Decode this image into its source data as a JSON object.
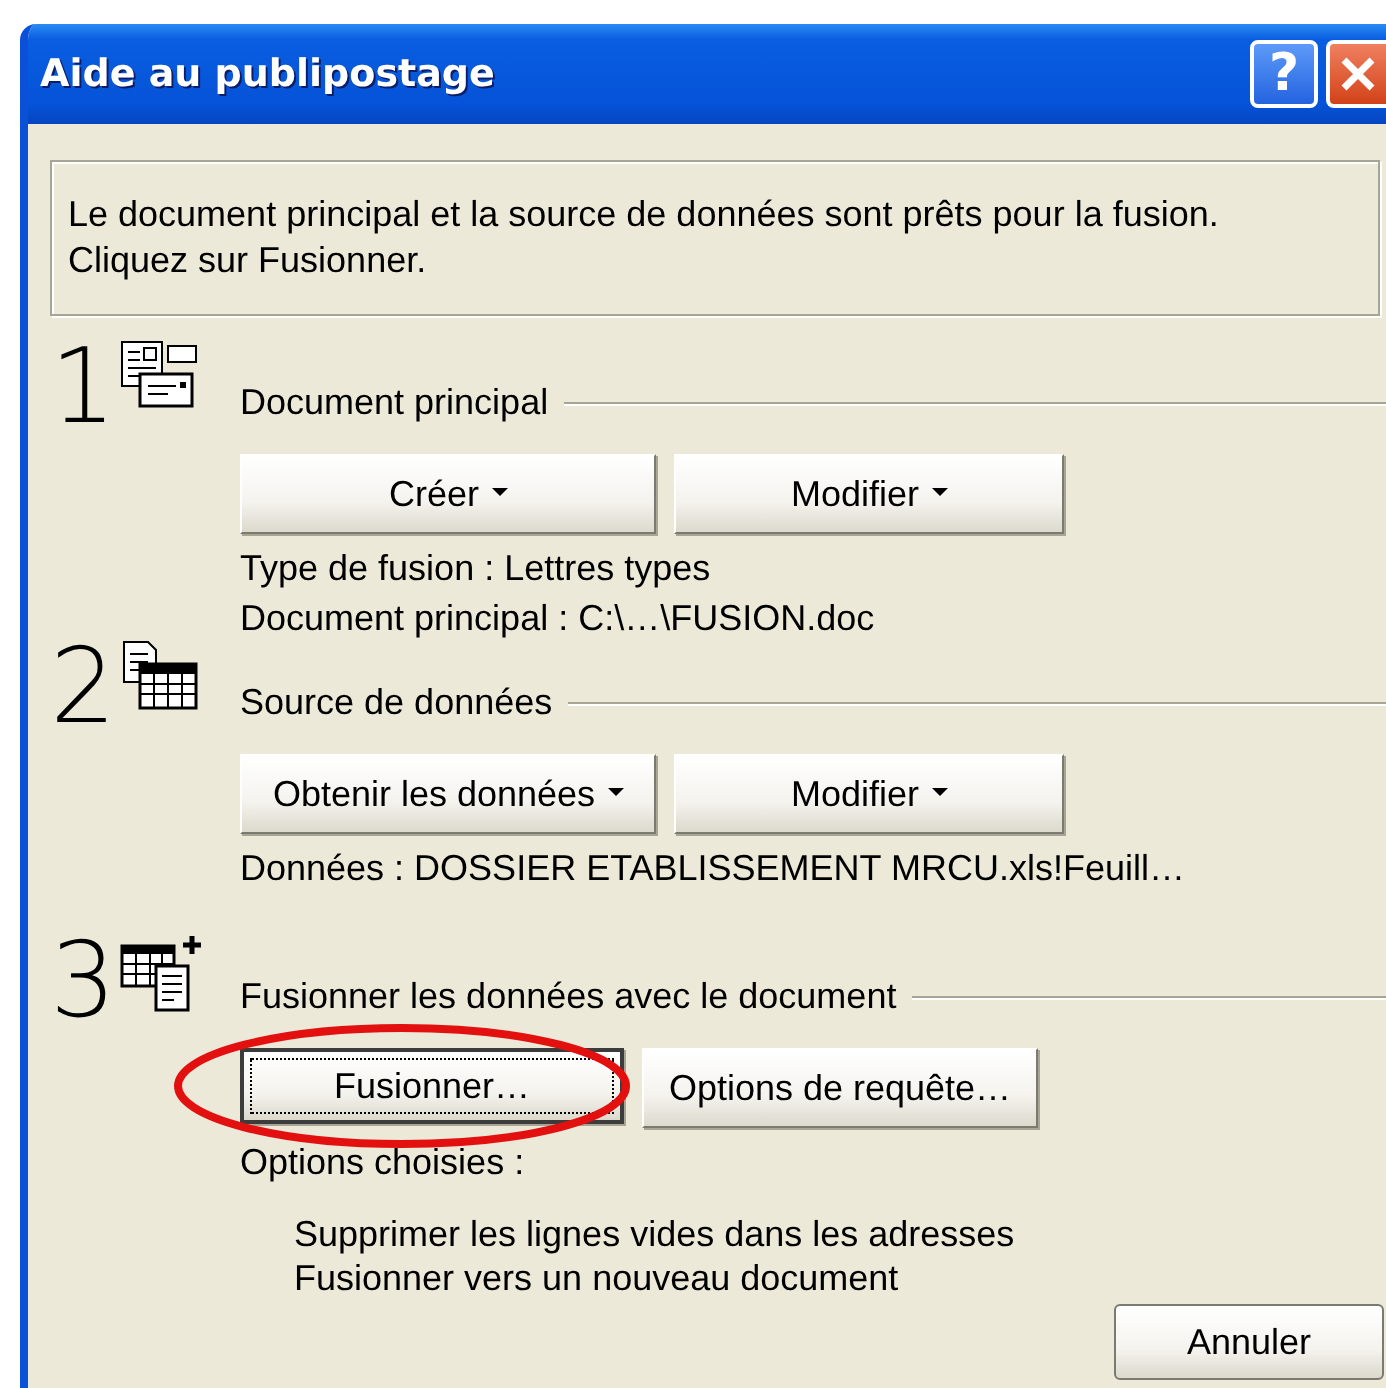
{
  "window": {
    "title": "Aide au publipostage",
    "title_buttons": [
      {
        "kind": "help",
        "label": "?"
      },
      {
        "kind": "close"
      }
    ]
  },
  "info_lines": [
    "Le document principal et la source de données sont prêts pour la fusion.",
    "Cliquez sur Fusionner."
  ],
  "steps": [
    {
      "number": "1",
      "heading": "Document principal",
      "buttons": [
        {
          "label": "Créer",
          "dropdown": true,
          "default": false,
          "circled": false
        },
        {
          "label": "Modifier",
          "dropdown": true,
          "default": false,
          "circled": false
        }
      ],
      "details": [
        "Type de fusion : Lettres types",
        "Document principal : C:\\…\\FUSION.doc"
      ]
    },
    {
      "number": "2",
      "heading": "Source de données",
      "buttons": [
        {
          "label": "Obtenir les données",
          "dropdown": true,
          "default": false,
          "circled": false
        },
        {
          "label": "Modifier",
          "dropdown": true,
          "default": false,
          "circled": false
        }
      ],
      "details": [
        "Données : DOSSIER ETABLISSEMENT MRCU.xls!Feuill…"
      ]
    },
    {
      "number": "3",
      "heading": "Fusionner les données avec le document",
      "buttons": [
        {
          "label": "Fusionner…",
          "dropdown": false,
          "default": true,
          "circled": true
        },
        {
          "label": "Options de requête…",
          "dropdown": false,
          "default": false,
          "circled": false
        }
      ],
      "details": [
        "Options choisies :"
      ],
      "options": [
        "Supprimer les lignes vides dans les adresses",
        "Fusionner vers un nouveau document"
      ]
    }
  ],
  "cancel_button": "Annuler"
}
